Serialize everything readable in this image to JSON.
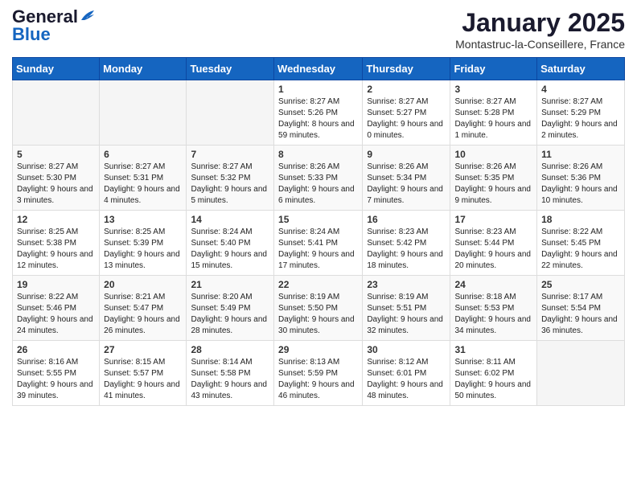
{
  "logo": {
    "general": "General",
    "blue": "Blue"
  },
  "title": "January 2025",
  "location": "Montastruc-la-Conseillere, France",
  "weekdays": [
    "Sunday",
    "Monday",
    "Tuesday",
    "Wednesday",
    "Thursday",
    "Friday",
    "Saturday"
  ],
  "weeks": [
    [
      {
        "num": "",
        "sunrise": "",
        "sunset": "",
        "daylight": ""
      },
      {
        "num": "",
        "sunrise": "",
        "sunset": "",
        "daylight": ""
      },
      {
        "num": "",
        "sunrise": "",
        "sunset": "",
        "daylight": ""
      },
      {
        "num": "1",
        "sunrise": "Sunrise: 8:27 AM",
        "sunset": "Sunset: 5:26 PM",
        "daylight": "Daylight: 8 hours and 59 minutes."
      },
      {
        "num": "2",
        "sunrise": "Sunrise: 8:27 AM",
        "sunset": "Sunset: 5:27 PM",
        "daylight": "Daylight: 9 hours and 0 minutes."
      },
      {
        "num": "3",
        "sunrise": "Sunrise: 8:27 AM",
        "sunset": "Sunset: 5:28 PM",
        "daylight": "Daylight: 9 hours and 1 minute."
      },
      {
        "num": "4",
        "sunrise": "Sunrise: 8:27 AM",
        "sunset": "Sunset: 5:29 PM",
        "daylight": "Daylight: 9 hours and 2 minutes."
      }
    ],
    [
      {
        "num": "5",
        "sunrise": "Sunrise: 8:27 AM",
        "sunset": "Sunset: 5:30 PM",
        "daylight": "Daylight: 9 hours and 3 minutes."
      },
      {
        "num": "6",
        "sunrise": "Sunrise: 8:27 AM",
        "sunset": "Sunset: 5:31 PM",
        "daylight": "Daylight: 9 hours and 4 minutes."
      },
      {
        "num": "7",
        "sunrise": "Sunrise: 8:27 AM",
        "sunset": "Sunset: 5:32 PM",
        "daylight": "Daylight: 9 hours and 5 minutes."
      },
      {
        "num": "8",
        "sunrise": "Sunrise: 8:26 AM",
        "sunset": "Sunset: 5:33 PM",
        "daylight": "Daylight: 9 hours and 6 minutes."
      },
      {
        "num": "9",
        "sunrise": "Sunrise: 8:26 AM",
        "sunset": "Sunset: 5:34 PM",
        "daylight": "Daylight: 9 hours and 7 minutes."
      },
      {
        "num": "10",
        "sunrise": "Sunrise: 8:26 AM",
        "sunset": "Sunset: 5:35 PM",
        "daylight": "Daylight: 9 hours and 9 minutes."
      },
      {
        "num": "11",
        "sunrise": "Sunrise: 8:26 AM",
        "sunset": "Sunset: 5:36 PM",
        "daylight": "Daylight: 9 hours and 10 minutes."
      }
    ],
    [
      {
        "num": "12",
        "sunrise": "Sunrise: 8:25 AM",
        "sunset": "Sunset: 5:38 PM",
        "daylight": "Daylight: 9 hours and 12 minutes."
      },
      {
        "num": "13",
        "sunrise": "Sunrise: 8:25 AM",
        "sunset": "Sunset: 5:39 PM",
        "daylight": "Daylight: 9 hours and 13 minutes."
      },
      {
        "num": "14",
        "sunrise": "Sunrise: 8:24 AM",
        "sunset": "Sunset: 5:40 PM",
        "daylight": "Daylight: 9 hours and 15 minutes."
      },
      {
        "num": "15",
        "sunrise": "Sunrise: 8:24 AM",
        "sunset": "Sunset: 5:41 PM",
        "daylight": "Daylight: 9 hours and 17 minutes."
      },
      {
        "num": "16",
        "sunrise": "Sunrise: 8:23 AM",
        "sunset": "Sunset: 5:42 PM",
        "daylight": "Daylight: 9 hours and 18 minutes."
      },
      {
        "num": "17",
        "sunrise": "Sunrise: 8:23 AM",
        "sunset": "Sunset: 5:44 PM",
        "daylight": "Daylight: 9 hours and 20 minutes."
      },
      {
        "num": "18",
        "sunrise": "Sunrise: 8:22 AM",
        "sunset": "Sunset: 5:45 PM",
        "daylight": "Daylight: 9 hours and 22 minutes."
      }
    ],
    [
      {
        "num": "19",
        "sunrise": "Sunrise: 8:22 AM",
        "sunset": "Sunset: 5:46 PM",
        "daylight": "Daylight: 9 hours and 24 minutes."
      },
      {
        "num": "20",
        "sunrise": "Sunrise: 8:21 AM",
        "sunset": "Sunset: 5:47 PM",
        "daylight": "Daylight: 9 hours and 26 minutes."
      },
      {
        "num": "21",
        "sunrise": "Sunrise: 8:20 AM",
        "sunset": "Sunset: 5:49 PM",
        "daylight": "Daylight: 9 hours and 28 minutes."
      },
      {
        "num": "22",
        "sunrise": "Sunrise: 8:19 AM",
        "sunset": "Sunset: 5:50 PM",
        "daylight": "Daylight: 9 hours and 30 minutes."
      },
      {
        "num": "23",
        "sunrise": "Sunrise: 8:19 AM",
        "sunset": "Sunset: 5:51 PM",
        "daylight": "Daylight: 9 hours and 32 minutes."
      },
      {
        "num": "24",
        "sunrise": "Sunrise: 8:18 AM",
        "sunset": "Sunset: 5:53 PM",
        "daylight": "Daylight: 9 hours and 34 minutes."
      },
      {
        "num": "25",
        "sunrise": "Sunrise: 8:17 AM",
        "sunset": "Sunset: 5:54 PM",
        "daylight": "Daylight: 9 hours and 36 minutes."
      }
    ],
    [
      {
        "num": "26",
        "sunrise": "Sunrise: 8:16 AM",
        "sunset": "Sunset: 5:55 PM",
        "daylight": "Daylight: 9 hours and 39 minutes."
      },
      {
        "num": "27",
        "sunrise": "Sunrise: 8:15 AM",
        "sunset": "Sunset: 5:57 PM",
        "daylight": "Daylight: 9 hours and 41 minutes."
      },
      {
        "num": "28",
        "sunrise": "Sunrise: 8:14 AM",
        "sunset": "Sunset: 5:58 PM",
        "daylight": "Daylight: 9 hours and 43 minutes."
      },
      {
        "num": "29",
        "sunrise": "Sunrise: 8:13 AM",
        "sunset": "Sunset: 5:59 PM",
        "daylight": "Daylight: 9 hours and 46 minutes."
      },
      {
        "num": "30",
        "sunrise": "Sunrise: 8:12 AM",
        "sunset": "Sunset: 6:01 PM",
        "daylight": "Daylight: 9 hours and 48 minutes."
      },
      {
        "num": "31",
        "sunrise": "Sunrise: 8:11 AM",
        "sunset": "Sunset: 6:02 PM",
        "daylight": "Daylight: 9 hours and 50 minutes."
      },
      {
        "num": "",
        "sunrise": "",
        "sunset": "",
        "daylight": ""
      }
    ]
  ]
}
